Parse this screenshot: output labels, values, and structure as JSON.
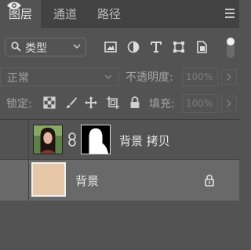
{
  "tabs": [
    {
      "label": "图层",
      "active": true
    },
    {
      "label": "通道",
      "active": false
    },
    {
      "label": "路径",
      "active": false
    }
  ],
  "filter": {
    "kind_label": "类型",
    "icons": [
      "image-filter-icon",
      "adjustment-filter-icon",
      "type-filter-icon",
      "shape-filter-icon",
      "smart-object-filter-icon"
    ],
    "toggle_on": true
  },
  "blend": {
    "mode": "正常",
    "opacity_label": "不透明度:",
    "opacity_value": "100%"
  },
  "locks": {
    "label": "锁定:",
    "icons": [
      "lock-transparent-pixels-icon",
      "lock-image-pixels-icon",
      "lock-position-icon",
      "prevent-auto-nesting-icon",
      "lock-all-icon"
    ],
    "fill_label": "填充:",
    "fill_value": "100%"
  },
  "layers": [
    {
      "name": "背景 拷贝",
      "visible": true,
      "selected": false,
      "has_mask": true,
      "locked": false
    },
    {
      "name": "背景",
      "visible": true,
      "selected": true,
      "has_mask": false,
      "locked": true,
      "fill_color": "#e6c8a8"
    }
  ],
  "colors": {
    "panel_bg": "#535353",
    "tab_bar_bg": "#424242",
    "selected_layer_bg": "#696969",
    "text": "#d6d6d6"
  }
}
